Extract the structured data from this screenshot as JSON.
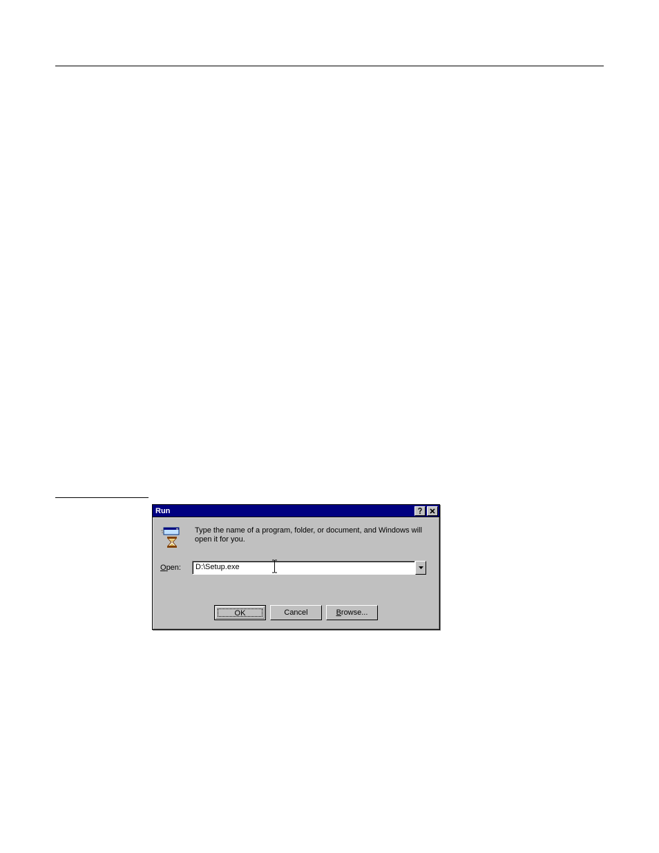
{
  "dialog": {
    "title": "Run",
    "message": "Type the name of a program, folder, or document, and Windows will open it for you.",
    "open_label_pre": "O",
    "open_label_post": "pen:",
    "open_value": "D:\\Setup.exe",
    "buttons": {
      "ok": "OK",
      "cancel": "Cancel",
      "browse_pre": "B",
      "browse_post": "rowse..."
    }
  }
}
